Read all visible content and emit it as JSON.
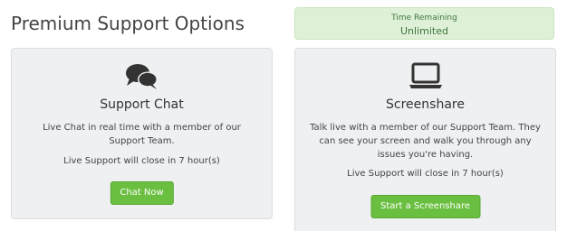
{
  "page": {
    "title": "Premium Support Options"
  },
  "time_remaining": {
    "label": "Time Remaining",
    "value": "Unlimited"
  },
  "chat_card": {
    "icon": "chat-bubbles-icon",
    "title": "Support Chat",
    "description": "Live Chat in real time with a member of our Support Team.",
    "close_notice": "Live Support will close in 7 hour(s)",
    "button_label": "Chat Now"
  },
  "screenshare_card": {
    "icon": "laptop-icon",
    "title": "Screenshare",
    "description": "Talk live with a member of our Support Team. They can see your screen and walk you through any issues you're having.",
    "close_notice": "Live Support will close in 7 hour(s)",
    "button_label": "Start a Screenshare"
  },
  "colors": {
    "accent_button": "#6abf40",
    "time_box_bg": "#dff0d8",
    "time_box_text": "#3c763d",
    "card_bg": "#eef0f2"
  }
}
